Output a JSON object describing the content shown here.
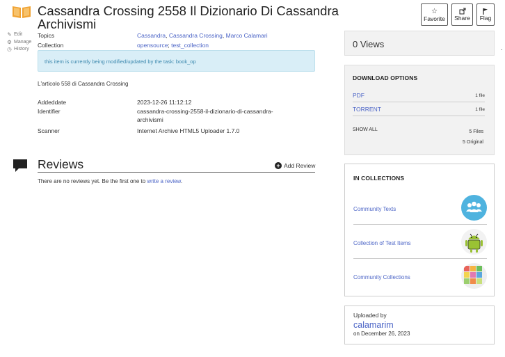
{
  "title": "Cassandra Crossing 2558 Il Dizionario Di Cassandra Archivismi",
  "side_actions": [
    {
      "icon": "pencil-icon",
      "label": "Edit"
    },
    {
      "icon": "gear-icon",
      "label": "Manage"
    },
    {
      "icon": "clock-icon",
      "label": "History"
    }
  ],
  "buttons": {
    "favorite": {
      "icon": "star-icon",
      "label": "Favorite"
    },
    "share": {
      "icon": "share-icon",
      "label": "Share"
    },
    "flag": {
      "icon": "flag-icon",
      "label": "Flag"
    }
  },
  "metadata": {
    "topics_key": "Topics",
    "topics": [
      "Cassandra",
      "Cassandra Crossing",
      "Marco Calamari"
    ],
    "collection_key": "Collection",
    "collections": [
      "opensource",
      "test_collection"
    ],
    "notice": "this item is currently being modified/updated by the task: book_op",
    "description": "L'articolo 558 di Cassandra Crossing",
    "addeddate_key": "Addeddate",
    "addeddate": "2023-12-26 11:12:12",
    "identifier_key": "Identifier",
    "identifier_line1": "cassandra-crossing-2558-il-dizionario-di-cassandra-",
    "identifier_line2": "archivismi",
    "scanner_key": "Scanner",
    "scanner": "Internet Archive HTML5 Uploader 1.7.0"
  },
  "reviews": {
    "title": "Reviews",
    "add_label": "Add Review",
    "empty_text": "There are no reviews yet. Be the first one to ",
    "empty_link": "write a review",
    "empty_end": "."
  },
  "views": "0 Views",
  "download": {
    "heading": "DOWNLOAD OPTIONS",
    "options": [
      {
        "label": "PDF",
        "count": "1 file"
      },
      {
        "label": "TORRENT",
        "count": "1 file"
      }
    ],
    "show_all": "SHOW ALL",
    "files": "5 Files",
    "original": "5 Original"
  },
  "in_collections": {
    "heading": "IN COLLECTIONS",
    "items": [
      {
        "label": "Community Texts",
        "icon": "people-group-icon"
      },
      {
        "label": "Collection of Test Items",
        "icon": "android-robot-icon"
      },
      {
        "label": "Community Collections",
        "icon": "colorful-mosaic-icon"
      }
    ]
  },
  "uploaded": {
    "by_label": "Uploaded by",
    "user": "calamarim",
    "date": "on December 26, 2023"
  },
  "colors": {
    "link": "#4b64c6",
    "book_icon": "#f0a232",
    "notice_bg": "#d9eef7",
    "notice_text": "#3a87ad"
  }
}
